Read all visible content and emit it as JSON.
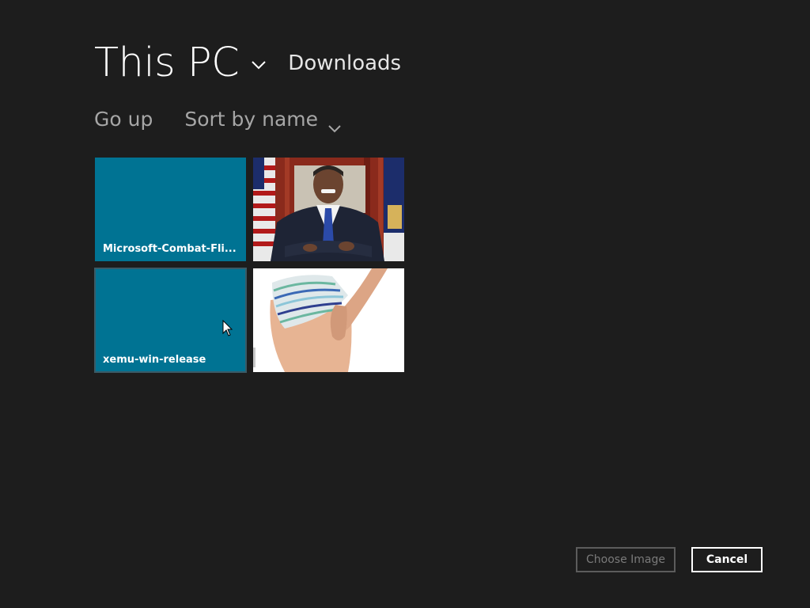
{
  "header": {
    "location_title": "This PC",
    "folder_label": "Downloads"
  },
  "commands": {
    "go_up": "Go up",
    "sort": "Sort by name"
  },
  "tiles": [
    {
      "type": "folder",
      "name": "Microsoft-Combat-Fli..."
    },
    {
      "type": "image",
      "content": "photo-portrait"
    },
    {
      "type": "folder",
      "name": "xemu-win-release"
    },
    {
      "type": "image",
      "content": "photo-underwear"
    }
  ],
  "buttons": {
    "choose": "Choose Image",
    "cancel": "Cancel"
  },
  "colors": {
    "background": "#1d1d1d",
    "folder_tile": "#007393",
    "disabled_text": "#7a7a7a"
  }
}
